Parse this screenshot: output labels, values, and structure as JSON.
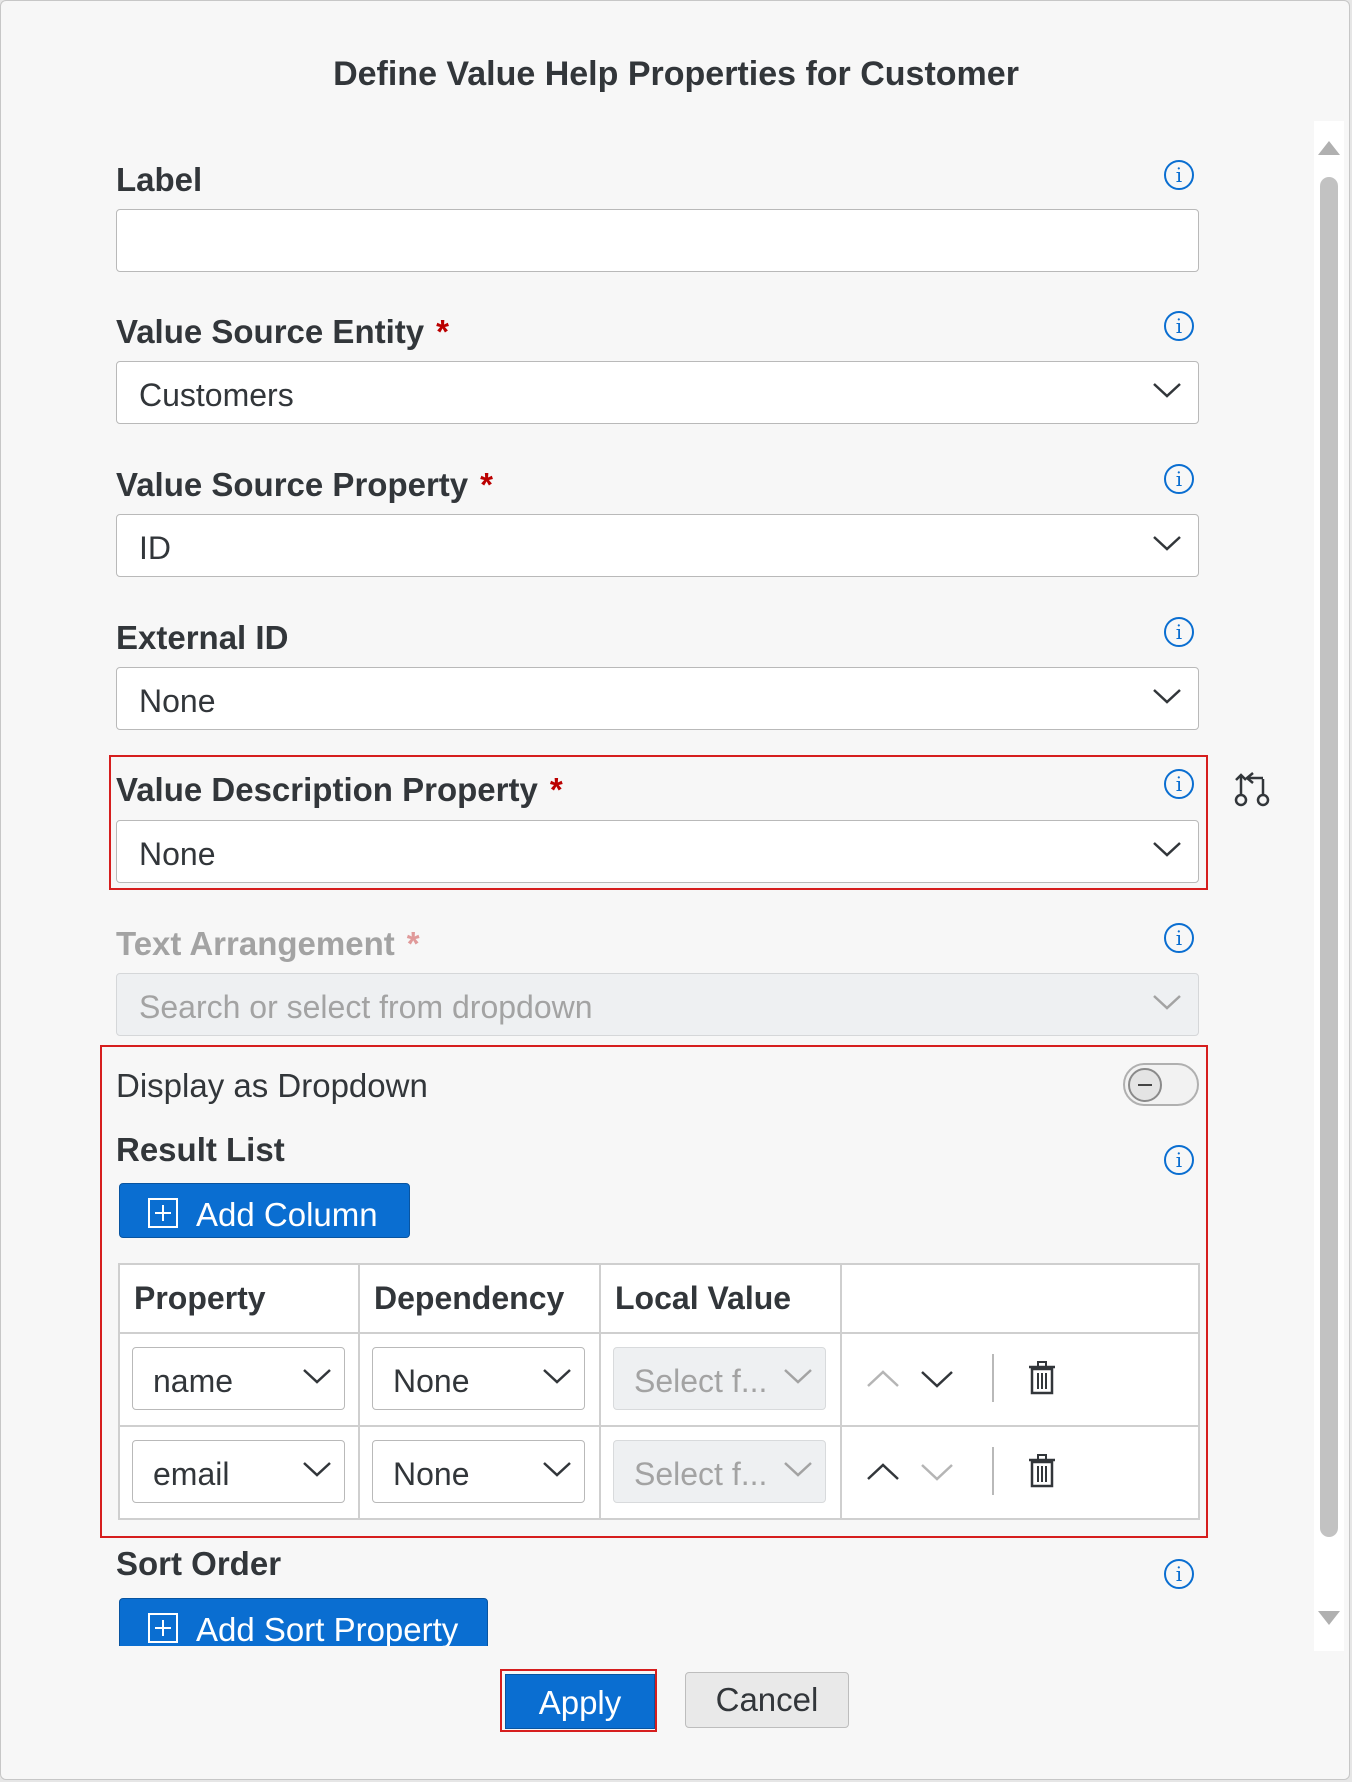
{
  "dialog": {
    "title": "Define Value Help Properties for Customer",
    "accent_color": "#0a6ed1",
    "highlight_color": "#d61e1e",
    "required_color": "#bb0000"
  },
  "fields": {
    "label": {
      "label": "Label",
      "value": ""
    },
    "value_source_entity": {
      "label": "Value Source Entity",
      "required_mark": "*",
      "value": "Customers"
    },
    "value_source_property": {
      "label": "Value Source Property",
      "required_mark": "*",
      "value": "ID"
    },
    "external_id": {
      "label": "External ID",
      "value": "None"
    },
    "value_description_property": {
      "label": "Value Description Property",
      "required_mark": "*",
      "value": "None"
    },
    "text_arrangement": {
      "label": "Text Arrangement",
      "required_mark": "*",
      "placeholder": "Search or select from dropdown"
    }
  },
  "display_as_dropdown": {
    "label": "Display as Dropdown",
    "enabled": false
  },
  "result_list": {
    "label": "Result List",
    "add_button": "Add Column",
    "columns": [
      "Property",
      "Dependency",
      "Local Value",
      ""
    ],
    "rows": [
      {
        "property": "name",
        "dependency": "None",
        "local_value_placeholder": "Select f...",
        "up_enabled": false,
        "down_enabled": true
      },
      {
        "property": "email",
        "dependency": "None",
        "local_value_placeholder": "Select f...",
        "up_enabled": true,
        "down_enabled": false
      }
    ]
  },
  "sort_order": {
    "label": "Sort Order",
    "add_button": "Add Sort Property"
  },
  "footer": {
    "apply": "Apply",
    "cancel": "Cancel"
  },
  "icons": [
    "info-icon",
    "chevron-down-icon",
    "compare-icon",
    "add-icon",
    "arrow-up-icon",
    "arrow-down-icon",
    "trash-icon"
  ]
}
